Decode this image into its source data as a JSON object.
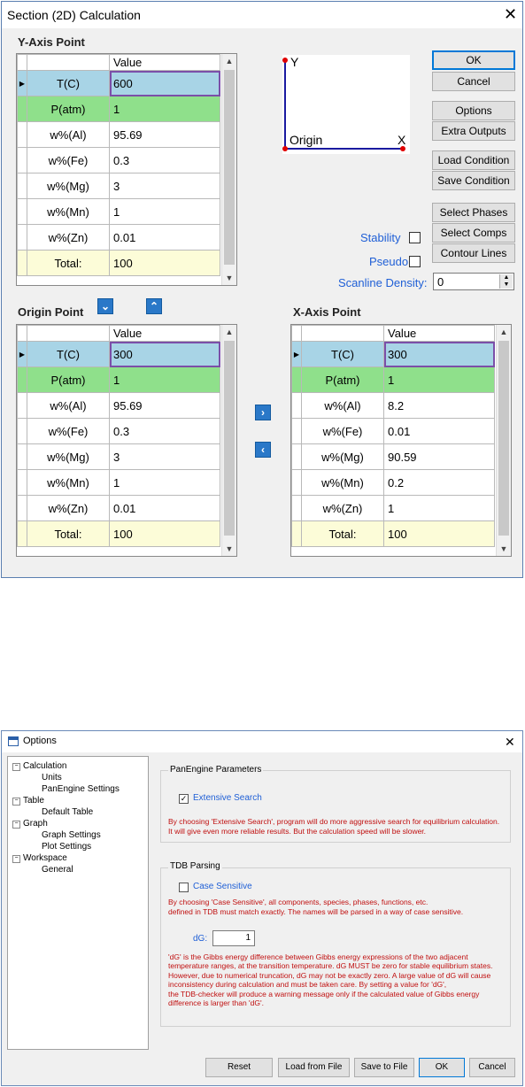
{
  "dialog1": {
    "title": "Section (2D) Calculation",
    "close_label": "✕",
    "y_axis_label": "Y-Axis Point",
    "origin_label": "Origin Point",
    "x_axis_label": "X-Axis Point",
    "value_header": "Value",
    "y_grid": [
      {
        "name": "T(C)",
        "value": "600"
      },
      {
        "name": "P(atm)",
        "value": "1"
      },
      {
        "name": "w%(Al)",
        "value": "95.69"
      },
      {
        "name": "w%(Fe)",
        "value": "0.3"
      },
      {
        "name": "w%(Mg)",
        "value": "3"
      },
      {
        "name": "w%(Mn)",
        "value": "1"
      },
      {
        "name": "w%(Zn)",
        "value": "0.01"
      },
      {
        "name": "Total:",
        "value": "100"
      }
    ],
    "origin_grid": [
      {
        "name": "T(C)",
        "value": "300"
      },
      {
        "name": "P(atm)",
        "value": "1"
      },
      {
        "name": "w%(Al)",
        "value": "95.69"
      },
      {
        "name": "w%(Fe)",
        "value": "0.3"
      },
      {
        "name": "w%(Mg)",
        "value": "3"
      },
      {
        "name": "w%(Mn)",
        "value": "1"
      },
      {
        "name": "w%(Zn)",
        "value": "0.01"
      },
      {
        "name": "Total:",
        "value": "100"
      }
    ],
    "x_grid": [
      {
        "name": "T(C)",
        "value": "300"
      },
      {
        "name": "P(atm)",
        "value": "1"
      },
      {
        "name": "w%(Al)",
        "value": "8.2"
      },
      {
        "name": "w%(Fe)",
        "value": "0.01"
      },
      {
        "name": "w%(Mg)",
        "value": "90.59"
      },
      {
        "name": "w%(Mn)",
        "value": "0.2"
      },
      {
        "name": "w%(Zn)",
        "value": "1"
      },
      {
        "name": "Total:",
        "value": "100"
      }
    ],
    "diagram": {
      "y": "Y",
      "origin": "Origin",
      "x": "X"
    },
    "buttons": {
      "ok": "OK",
      "cancel": "Cancel",
      "options": "Options",
      "extra_outputs": "Extra Outputs",
      "load_condition": "Load Condition",
      "save_condition": "Save Condition",
      "select_phases": "Select Phases",
      "select_comps": "Select Comps",
      "contour_lines": "Contour Lines"
    },
    "stability_label": "Stability",
    "pseudo_label": "Pseudo",
    "scanline_label": "Scanline Density:",
    "scanline_value": "0",
    "colors": {
      "selected_row": "#a8d4e6",
      "pressure_row": "#8fe08b",
      "total_row": "#fcfcd8",
      "accent": "#1f5fd6"
    }
  },
  "dialog2": {
    "title": "Options",
    "close_label": "✕",
    "tree": [
      {
        "label": "Calculation",
        "level": 0,
        "expander": "⊟"
      },
      {
        "label": "Units",
        "level": 1
      },
      {
        "label": "PanEngine Settings",
        "level": 1
      },
      {
        "label": "Table",
        "level": 0,
        "expander": "⊟"
      },
      {
        "label": "Default Table",
        "level": 1
      },
      {
        "label": "Graph",
        "level": 0,
        "expander": "⊟"
      },
      {
        "label": "Graph Settings",
        "level": 1
      },
      {
        "label": "Plot Settings",
        "level": 1
      },
      {
        "label": "Workspace",
        "level": 0,
        "expander": "⊟"
      },
      {
        "label": "General",
        "level": 1
      }
    ],
    "panengine_group": "PanEngine Parameters",
    "extensive_search_label": "Extensive Search",
    "extensive_search_checked": true,
    "extensive_desc_1": "By choosing 'Extensive Search', program will do more aggressive search for equilibrium calculation.",
    "extensive_desc_2": "It will give even more reliable results. But the calculation speed will be slower.",
    "tdb_group": "TDB Parsing",
    "case_sensitive_label": "Case Sensitive",
    "case_sensitive_checked": false,
    "case_desc_1": "By choosing 'Case Sensitive', all components, species, phases, functions, etc.",
    "case_desc_2": "defined in TDB must match exactly. The names will be parsed in a way of case sensitive.",
    "dg_label": "dG:",
    "dg_value": "1",
    "dg_desc": [
      "'dG' is the Gibbs energy difference between Gibbs energy expressions of the two adjacent",
      "temperature ranges, at the transition temperature. dG MUST be zero for stable equilibrium states.",
      "However, due to numerical truncation, dG may not be exactly zero. A large value of dG will cause",
      "inconsistency during calculation and must be taken care. By setting a value for 'dG',",
      "the TDB-checker will produce a warning message only if the calculated value of Gibbs energy",
      "difference is larger than 'dG'."
    ],
    "buttons": {
      "reset": "Reset",
      "load_from_file": "Load from File",
      "save_to_file": "Save to File",
      "ok": "OK",
      "cancel": "Cancel"
    }
  }
}
